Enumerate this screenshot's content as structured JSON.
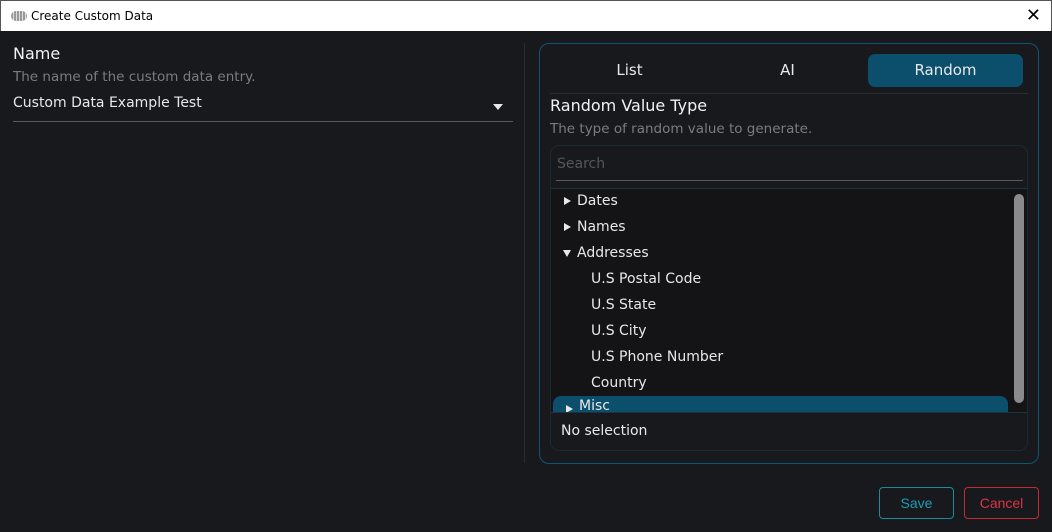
{
  "window": {
    "title": "Create Custom Data"
  },
  "name_field": {
    "label": "Name",
    "description": "The name of the custom data entry.",
    "value": "Custom Data Example Test"
  },
  "tabs": [
    {
      "label": "List"
    },
    {
      "label": "AI"
    },
    {
      "label": "Random",
      "active": true
    }
  ],
  "random": {
    "label": "Random Value Type",
    "description": "The type of random value to generate.",
    "search_placeholder": "Search",
    "items": [
      {
        "label": "Dates",
        "expanded": false
      },
      {
        "label": "Names",
        "expanded": false
      },
      {
        "label": "Addresses",
        "expanded": true
      },
      {
        "label": "U.S Postal Code"
      },
      {
        "label": "U.S State"
      },
      {
        "label": "U.S City"
      },
      {
        "label": "U.S Phone Number"
      },
      {
        "label": "Country"
      },
      {
        "label": "Misc",
        "expanded": false
      }
    ],
    "selection_text": "No selection"
  },
  "buttons": {
    "save": "Save",
    "cancel": "Cancel"
  },
  "colors": {
    "accent": "#0b4f6c",
    "save": "#1e9cb4",
    "cancel": "#dc3340"
  }
}
